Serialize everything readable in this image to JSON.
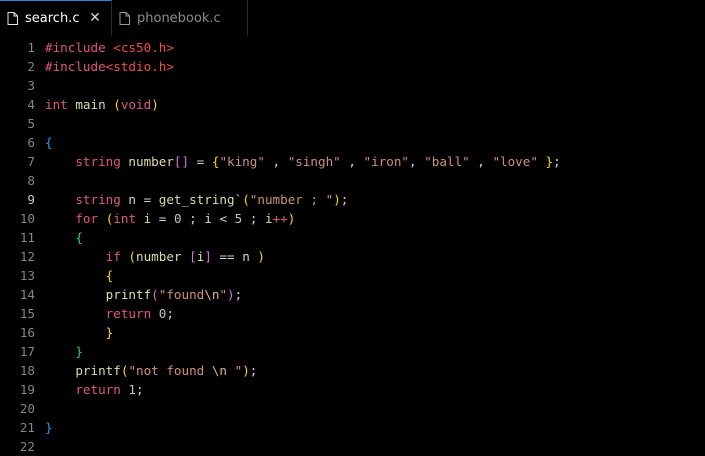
{
  "tabs": [
    {
      "label": "search.c",
      "active": true,
      "icon": "file-icon"
    },
    {
      "label": "phonebook.c",
      "active": false,
      "icon": "file-icon"
    }
  ],
  "close_glyph": "✕",
  "lines": [
    {
      "n": "1",
      "tokens": [
        [
          "inc",
          "#include "
        ],
        [
          "red",
          "<cs50.h>"
        ]
      ]
    },
    {
      "n": "2",
      "tokens": [
        [
          "inc",
          "#include"
        ],
        [
          "red",
          "<stdio.h>"
        ]
      ]
    },
    {
      "n": "3",
      "tokens": []
    },
    {
      "n": "4",
      "tokens": [
        [
          "typ",
          "int "
        ],
        [
          "fn",
          "main"
        ],
        [
          "id",
          " "
        ],
        [
          "br1",
          "("
        ],
        [
          "typ",
          "void"
        ],
        [
          "br1",
          ")"
        ]
      ]
    },
    {
      "n": "5",
      "tokens": []
    },
    {
      "n": "6",
      "tokens": [
        [
          "br3",
          "{"
        ]
      ]
    },
    {
      "n": "7",
      "tokens": [
        [
          "id",
          "    "
        ],
        [
          "typ",
          "string "
        ],
        [
          "fn",
          "number"
        ],
        [
          "br2",
          "[]"
        ],
        [
          "id",
          " = "
        ],
        [
          "br1",
          "{"
        ],
        [
          "str",
          "\"king\""
        ],
        [
          "id",
          " , "
        ],
        [
          "str",
          "\"singh\""
        ],
        [
          "id",
          " , "
        ],
        [
          "str",
          "\"iron\""
        ],
        [
          "id",
          ", "
        ],
        [
          "str",
          "\"ball\""
        ],
        [
          "id",
          " , "
        ],
        [
          "str",
          "\"love\""
        ],
        [
          "id",
          " "
        ],
        [
          "br1",
          "}"
        ],
        [
          "id",
          ";"
        ]
      ]
    },
    {
      "n": "8",
      "tokens": []
    },
    {
      "n": "9",
      "tokens": [
        [
          "id",
          "    "
        ],
        [
          "typ",
          "string "
        ],
        [
          "fn",
          "n"
        ],
        [
          "id",
          " = "
        ],
        [
          "fn",
          "get_string"
        ],
        [
          "id",
          "`"
        ],
        [
          "br1",
          "("
        ],
        [
          "str",
          "\"number ; \""
        ],
        [
          "br1",
          ")"
        ],
        [
          "id",
          ";"
        ]
      ]
    },
    {
      "n": "10",
      "tokens": [
        [
          "id",
          "    "
        ],
        [
          "typ",
          "for "
        ],
        [
          "br1",
          "("
        ],
        [
          "typ",
          "int "
        ],
        [
          "fn",
          "i"
        ],
        [
          "id",
          " = "
        ],
        [
          "num",
          "0"
        ],
        [
          "id",
          " ; "
        ],
        [
          "fn",
          "i"
        ],
        [
          "id",
          " < "
        ],
        [
          "num",
          "5"
        ],
        [
          "id",
          " ; "
        ],
        [
          "fn",
          "i"
        ],
        [
          "typ",
          "++"
        ],
        [
          "br1",
          ")"
        ]
      ]
    },
    {
      "n": "11",
      "tokens": [
        [
          "id",
          "    "
        ],
        [
          "grn",
          "{"
        ]
      ]
    },
    {
      "n": "12",
      "tokens": [
        [
          "id",
          "        "
        ],
        [
          "typ",
          "if "
        ],
        [
          "br1",
          "("
        ],
        [
          "fn",
          "number "
        ],
        [
          "br2",
          "["
        ],
        [
          "fn",
          "i"
        ],
        [
          "br2",
          "]"
        ],
        [
          "id",
          " == "
        ],
        [
          "fn",
          "n"
        ],
        [
          "id",
          " "
        ],
        [
          "br1",
          ")"
        ]
      ]
    },
    {
      "n": "13",
      "tokens": [
        [
          "id",
          "        "
        ],
        [
          "br1",
          "{"
        ]
      ]
    },
    {
      "n": "14",
      "tokens": [
        [
          "id",
          "        "
        ],
        [
          "fn",
          "printf"
        ],
        [
          "br2",
          "("
        ],
        [
          "str",
          "\"found"
        ],
        [
          "esc",
          "\\n"
        ],
        [
          "str",
          "\""
        ],
        [
          "br2",
          ")"
        ],
        [
          "id",
          ";"
        ]
      ]
    },
    {
      "n": "15",
      "tokens": [
        [
          "id",
          "        "
        ],
        [
          "typ",
          "return "
        ],
        [
          "num",
          "0"
        ],
        [
          "id",
          ";"
        ]
      ]
    },
    {
      "n": "16",
      "tokens": [
        [
          "id",
          "        "
        ],
        [
          "br1",
          "}"
        ]
      ]
    },
    {
      "n": "17",
      "tokens": [
        [
          "id",
          "    "
        ],
        [
          "grn",
          "}"
        ]
      ]
    },
    {
      "n": "18",
      "tokens": [
        [
          "id",
          "    "
        ],
        [
          "fn",
          "printf"
        ],
        [
          "br1",
          "("
        ],
        [
          "str",
          "\"not found "
        ],
        [
          "esc",
          "\\n"
        ],
        [
          "str",
          " \""
        ],
        [
          "br1",
          ")"
        ],
        [
          "id",
          ";"
        ]
      ]
    },
    {
      "n": "19",
      "tokens": [
        [
          "id",
          "    "
        ],
        [
          "typ",
          "return "
        ],
        [
          "num",
          "1"
        ],
        [
          "id",
          ";"
        ]
      ]
    },
    {
      "n": "20",
      "tokens": []
    },
    {
      "n": "21",
      "tokens": [
        [
          "br3",
          "}"
        ]
      ]
    },
    {
      "n": "22",
      "tokens": []
    }
  ],
  "current_line": "9"
}
